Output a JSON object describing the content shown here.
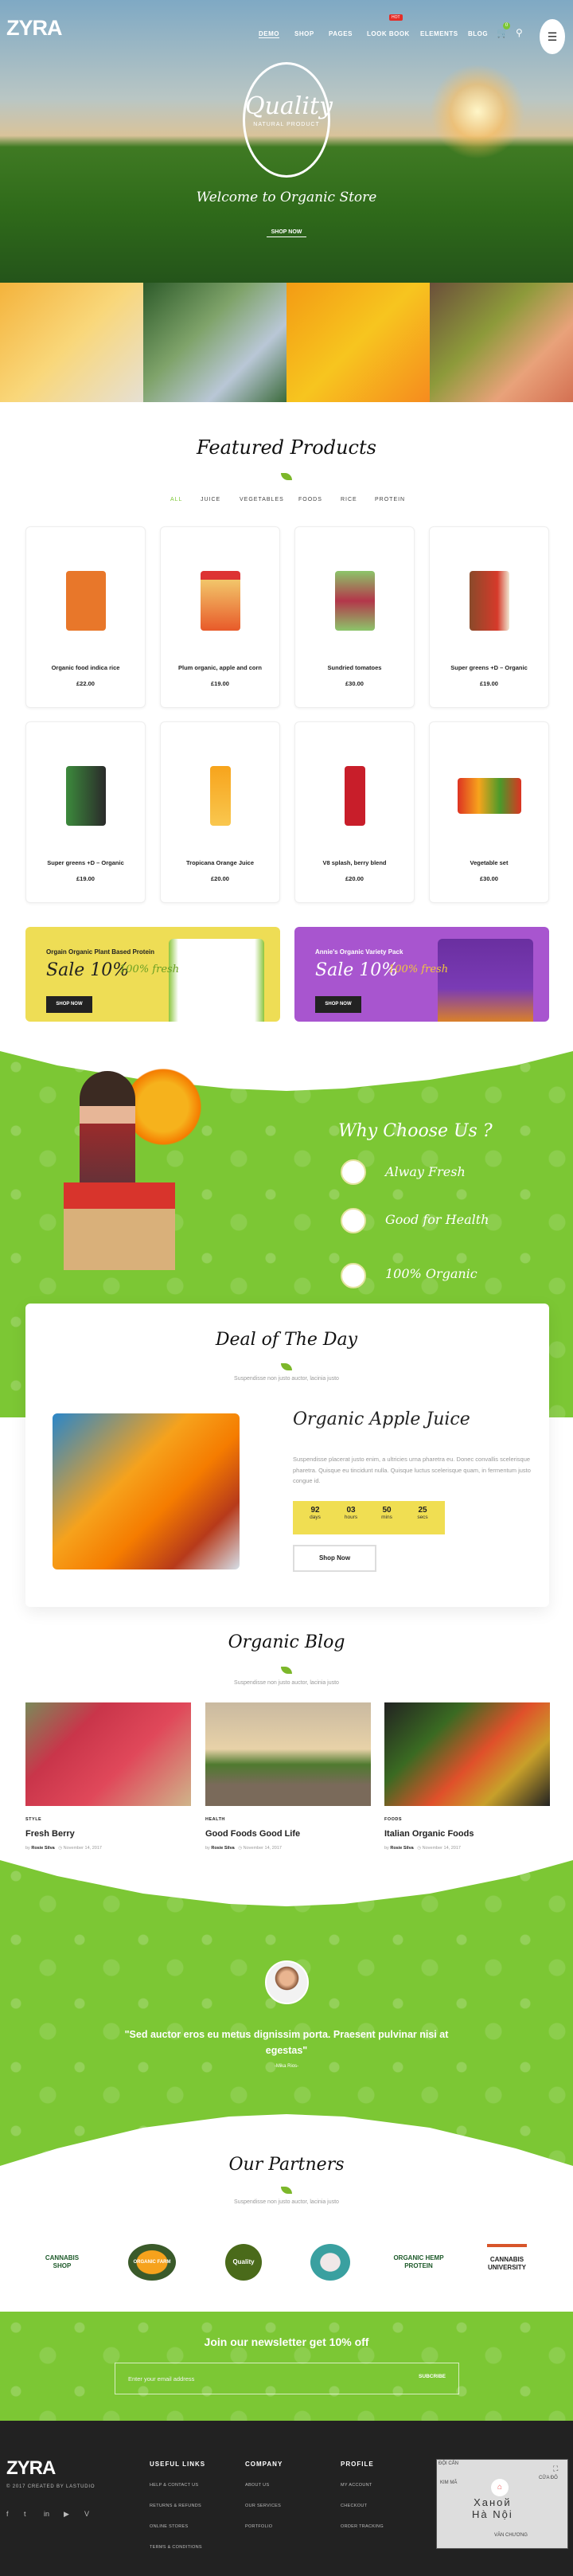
{
  "header": {
    "logo": "ZYRA",
    "nav": [
      "DEMO",
      "SHOP",
      "PAGES",
      "LOOK BOOK",
      "ELEMENTS",
      "BLOG"
    ],
    "hot_badge": "HOT",
    "cart_count": "0",
    "icons": [
      "cart-icon",
      "search-icon",
      "menu-icon"
    ]
  },
  "hero": {
    "badge_title": "Quality",
    "badge_sub": "NATURAL PRODUCT",
    "welcome": "Welcome to Organic Store",
    "cta": "SHOP NOW"
  },
  "featured": {
    "title": "Featured Products",
    "tabs": [
      "ALL",
      "JUICE",
      "VEGETABLES",
      "FOODS",
      "RICE",
      "PROTEIN"
    ],
    "active_tab": "ALL",
    "products": [
      {
        "name": "Organic food indica rice",
        "price": "£22.00"
      },
      {
        "name": "Plum organic, apple and corn",
        "price": "£19.00"
      },
      {
        "name": "Sundried tomatoes",
        "price": "£30.00"
      },
      {
        "name": "Super greens +D – Organic",
        "price": "£19.00"
      },
      {
        "name": "Super greens +D – Organic",
        "price": "£19.00"
      },
      {
        "name": "Tropicana Orange Juice",
        "price": "£20.00"
      },
      {
        "name": "V8 splash, berry blend",
        "price": "£20.00"
      },
      {
        "name": "Vegetable set",
        "price": "£30.00"
      }
    ]
  },
  "banners": [
    {
      "title": "Orgain Organic Plant Based Protein",
      "sale": "Sale 10%",
      "fresh": "100% fresh",
      "button": "SHOP NOW",
      "color": "#eedd55"
    },
    {
      "title": "Annie's Organic Variety Pack",
      "sale": "Sale 10%",
      "fresh": "100% fresh",
      "button": "SHOP NOW",
      "color": "#a855cf"
    }
  ],
  "why": {
    "title": "Why Choose Us ?",
    "items": [
      "Alway Fresh",
      "Good for Health",
      "100% Organic"
    ]
  },
  "deal": {
    "title": "Deal of The Day",
    "subtitle": "Suspendisse non justo auctor, lacinia justo",
    "product": "Organic Apple Juice",
    "description": "Suspendisse placerat justo enim, a ultricies urna pharetra eu. Donec convallis scelerisque pharetra. Quisque eu tincidunt nulla. Quisque luctus scelerisque quam, in fermentum justo congue id.",
    "countdown": [
      {
        "value": "92",
        "label": "days"
      },
      {
        "value": "03",
        "label": "hours"
      },
      {
        "value": "50",
        "label": "mins"
      },
      {
        "value": "25",
        "label": "secs"
      }
    ],
    "button": "Shop Now"
  },
  "blog": {
    "title": "Organic Blog",
    "subtitle": "Suspendisse non justo auctor, lacinia justo",
    "posts": [
      {
        "category": "STYLE",
        "title": "Fresh Berry",
        "by": "by",
        "author": "Rosie Silva",
        "date": "November 14, 2017"
      },
      {
        "category": "HEALTH",
        "title": "Good Foods Good Life",
        "by": "by",
        "author": "Rosie Silva",
        "date": "November 14, 2017"
      },
      {
        "category": "FOODS",
        "title": "Italian Organic Foods",
        "by": "by",
        "author": "Rosie Silva",
        "date": "November 14, 2017"
      }
    ]
  },
  "testimonial": {
    "quote": "\"Sed auctor eros eu metus dignissim porta. Praesent pulvinar nisi at egestas\"",
    "author": "-Mika Rios-"
  },
  "partners": {
    "title": "Our Partners",
    "subtitle": "Suspendisse non justo auctor, lacinia justo",
    "logos": [
      "CANNABIS SHOP",
      "ORGANIC FARM",
      "Quality",
      "",
      "ORGANIC HEMP PROTEIN",
      "CANNABIS UNIVERSITY"
    ]
  },
  "newsletter": {
    "heading": "Join our newsletter get 10% off",
    "placeholder": "Enter your email address",
    "button": "SUBCRIBE"
  },
  "footer": {
    "logo": "ZYRA",
    "copyright": "© 2017 CREATED BY LASTUDIO",
    "social": [
      "facebook-icon",
      "twitter-icon",
      "linkedin-icon",
      "youtube-icon",
      "vimeo-icon"
    ],
    "columns": [
      {
        "title": "USEFUL LINKS",
        "links": [
          "HELP & CONTACT US",
          "RETURNS & REFUNDS",
          "ONLINE STORES",
          "TERMS & CONDITIONS"
        ]
      },
      {
        "title": "COMPANY",
        "links": [
          "ABOUT US",
          "OUR SERVICES",
          "PORTFOLIO"
        ]
      },
      {
        "title": "PROFILE",
        "links": [
          "MY ACCOUNT",
          "CHECKOUT",
          "ORDER TRACKING"
        ]
      }
    ],
    "map": {
      "city_ru": "Ханой",
      "city": "Hà Nội",
      "labels": [
        "ĐỘI CẤN",
        "KIM MÃ",
        "CỬA ĐÔ",
        "VĂN CHƯƠNG"
      ]
    }
  },
  "colors": {
    "accent": "#7cc734",
    "countdown": "#f0de52",
    "footer": "#222222",
    "hot": "#e52d27"
  }
}
